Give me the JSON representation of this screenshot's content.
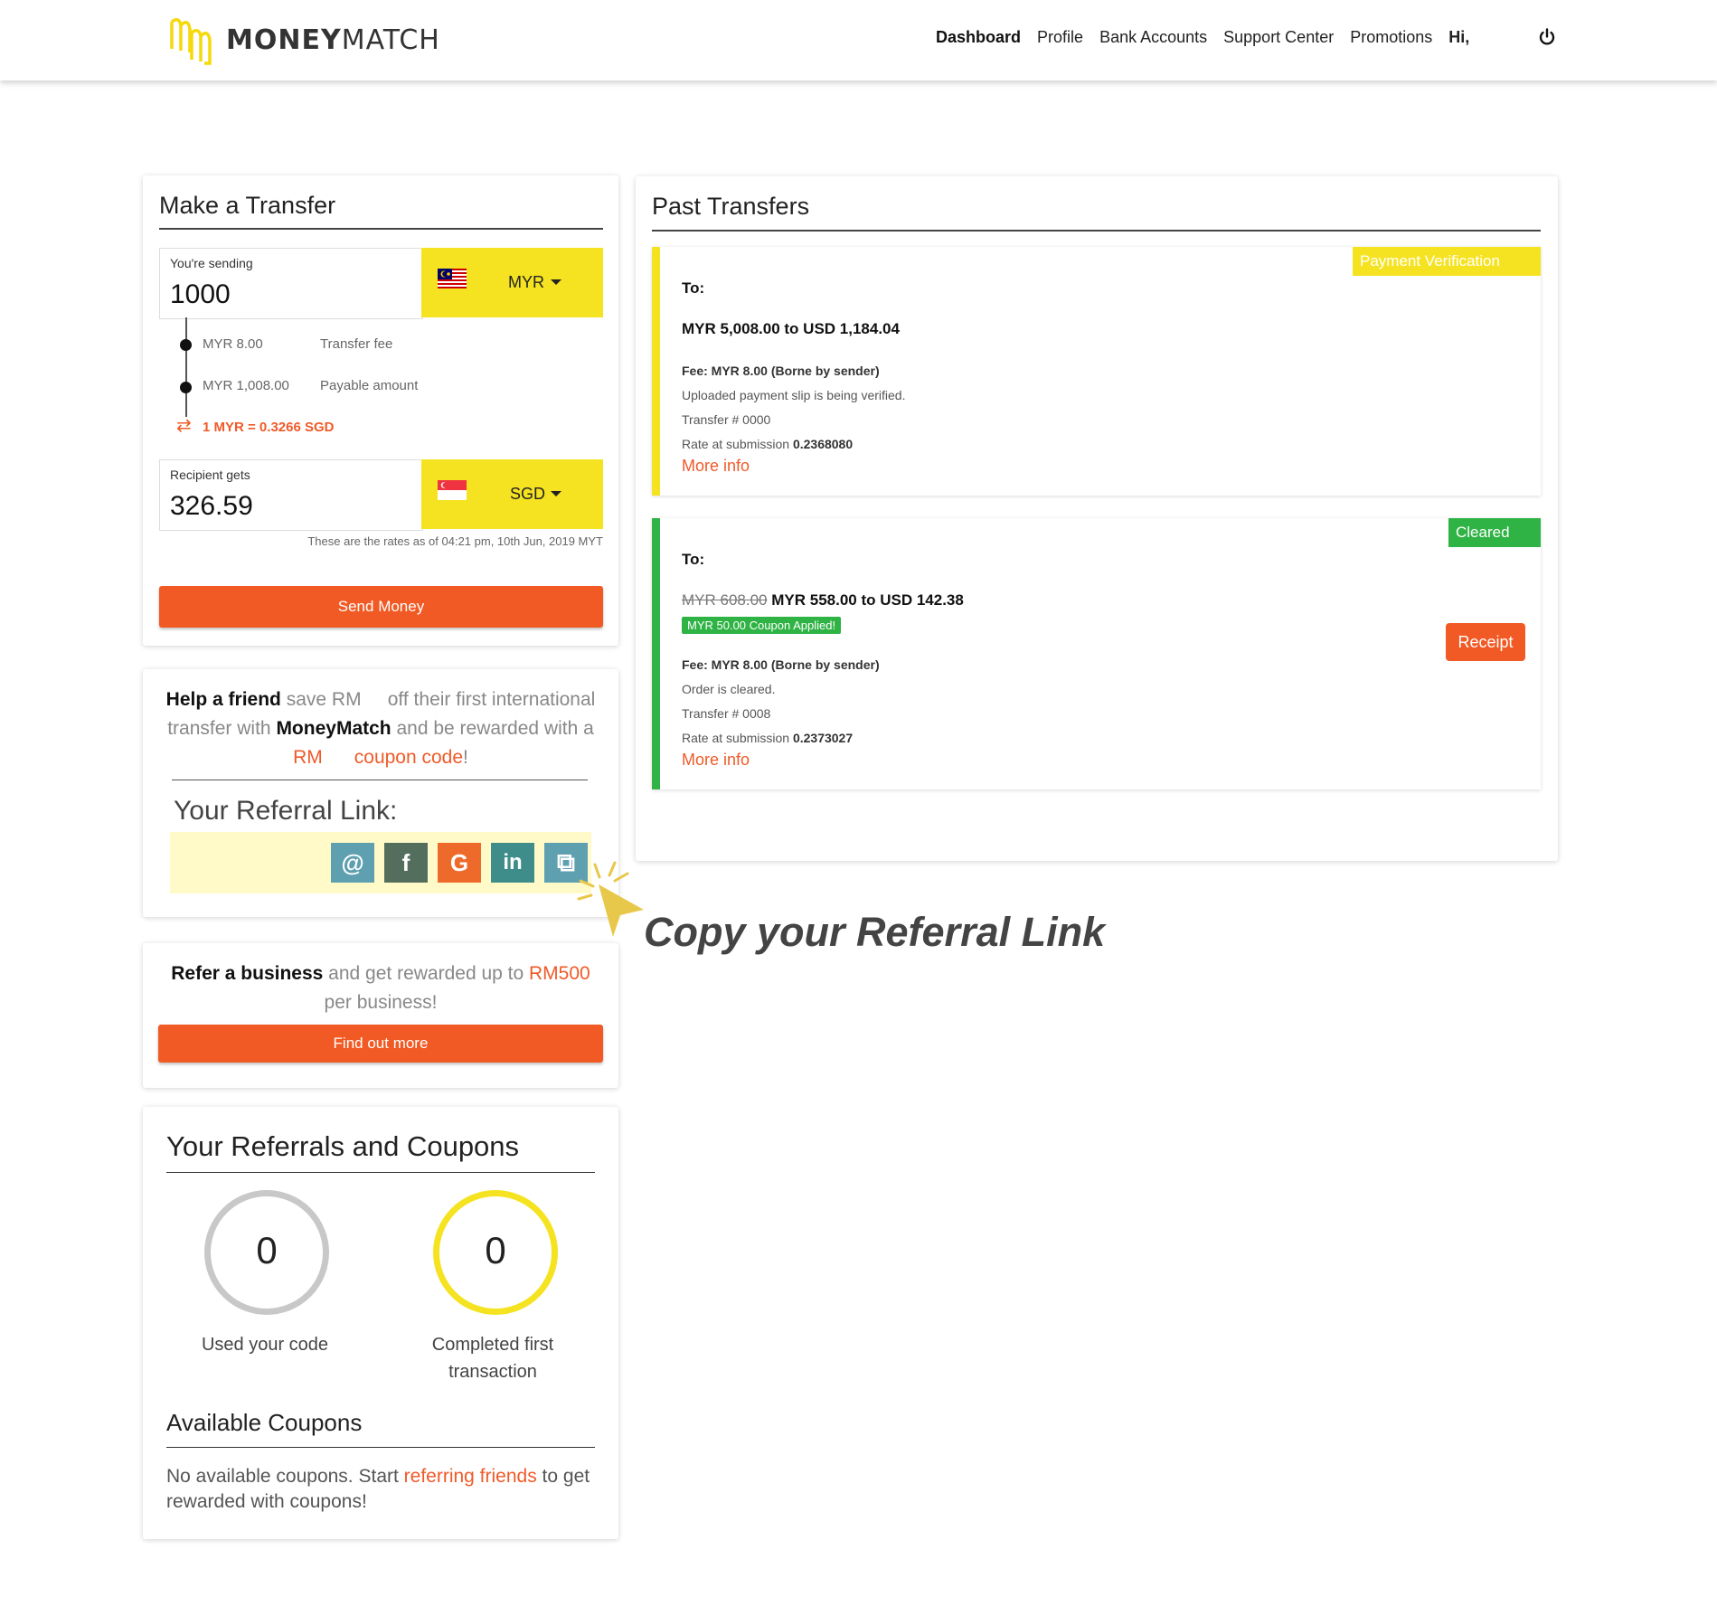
{
  "brand": {
    "name_bold": "MONEY",
    "name_light": "MATCH",
    "logo_color": "#f5d90a"
  },
  "nav": {
    "items": [
      "Dashboard",
      "Profile",
      "Bank Accounts",
      "Support Center",
      "Promotions"
    ],
    "active": "Dashboard",
    "greeting": "Hi,",
    "logout_icon": "power-icon"
  },
  "transfer": {
    "title": "Make a Transfer",
    "sending_label": "You're sending",
    "sending_value": "1000",
    "sending_currency": "MYR",
    "fee_amount": "MYR 8.00",
    "fee_label": "Transfer fee",
    "payable_amount": "MYR 1,008.00",
    "payable_label": "Payable amount",
    "rate": "1 MYR = 0.3266 SGD",
    "recipient_label": "Recipient gets",
    "recipient_value": "326.59",
    "recipient_currency": "SGD",
    "rates_note": "These are the rates as of 04:21 pm, 10th Jun, 2019 MYT",
    "send_button": "Send Money"
  },
  "referral": {
    "help_bold": "Help a friend",
    "help_rest1": " save RM ",
    "help_rest2": " off their first international transfer with ",
    "brand_bold": "MoneyMatch",
    "help_rest3": " and be rewarded with a ",
    "rm": "RM ",
    "coupon_code": " coupon code",
    "exclaim": "!",
    "link_label": "Your Referral Link:",
    "share_icons": [
      "email-icon",
      "facebook-icon",
      "google-icon",
      "linkedin-icon",
      "copy-icon"
    ],
    "share_glyphs": [
      "@",
      "f",
      "G",
      "in",
      "⧉"
    ],
    "callout": "Copy your Referral Link"
  },
  "business": {
    "bold": "Refer a business",
    "rest": " and get rewarded up to ",
    "amount": "RM500",
    "rest2": " per business!",
    "button": "Find out more"
  },
  "coupons": {
    "title": "Your Referrals and Coupons",
    "used_count": "0",
    "used_label": "Used your code",
    "completed_count": "0",
    "completed_label": "Completed first transaction",
    "available_title": "Available Coupons",
    "empty_text1": "No available coupons. Start ",
    "empty_link": "referring friends",
    "empty_text2": " to get rewarded with coupons!"
  },
  "past": {
    "title": "Past Transfers",
    "transfers": [
      {
        "status": "Payment Verification",
        "status_color": "#f5e321",
        "to_label": "To:",
        "amount": "MYR 5,008.00 to USD 1,184.04",
        "fee": "Fee: MYR 8.00 (Borne by sender)",
        "note": "Uploaded payment slip is being verified.",
        "transfer_no": "Transfer # 0000",
        "rate_label": "Rate at submission ",
        "rate_value": "0.2368080",
        "more": "More info"
      },
      {
        "status": "Cleared",
        "status_color": "#2fb344",
        "to_label": "To:",
        "amount_old": "MYR 608.00",
        "amount": "MYR 558.00 to USD 142.38",
        "coupon": "MYR 50.00 Coupon Applied!",
        "fee": "Fee: MYR 8.00 (Borne by sender)",
        "note": "Order is cleared.",
        "transfer_no": "Transfer # 0008",
        "rate_label": "Rate at submission ",
        "rate_value": "0.2373027",
        "more": "More info",
        "receipt": "Receipt"
      }
    ]
  }
}
